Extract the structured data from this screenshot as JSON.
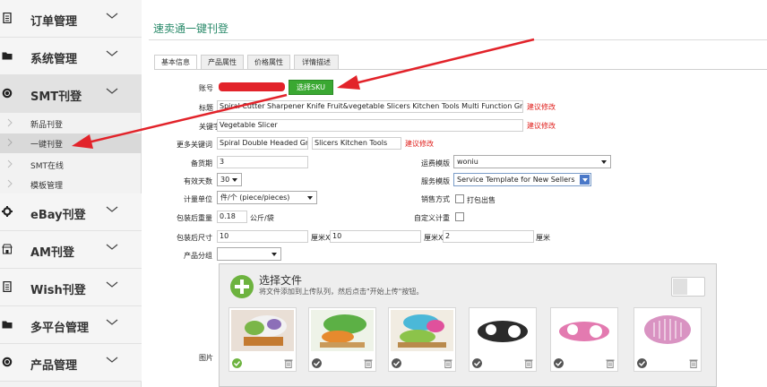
{
  "sidebar": {
    "nav": [
      {
        "label": "订单管理",
        "icon": "document-icon"
      },
      {
        "label": "系统管理",
        "icon": "folder-icon"
      },
      {
        "label": "SMT刊登",
        "icon": "globe-icon"
      },
      {
        "label": "eBay刊登",
        "icon": "gear-icon"
      },
      {
        "label": "AM刊登",
        "icon": "store-icon"
      },
      {
        "label": "Wish刊登",
        "icon": "document-icon"
      },
      {
        "label": "多平台管理",
        "icon": "folder-icon"
      },
      {
        "label": "产品管理",
        "icon": "globe-icon"
      }
    ],
    "sub_items": [
      {
        "label": "新品刊登"
      },
      {
        "label": "一键刊登"
      },
      {
        "label": "SMT在线"
      },
      {
        "label": "模板管理"
      }
    ]
  },
  "page": {
    "title": "速卖通一键刊登"
  },
  "tabs": [
    "基本信息",
    "产品属性",
    "价格属性",
    "详情描述"
  ],
  "form": {
    "account_label": "账号",
    "select_sku_button": "选择SKU",
    "title_label": "标题",
    "title_value": "Spiral Cutter Sharpener Knife Fruit&vegetable Slicers Kitchen Tools Multi Function Grate",
    "title_hint": "建议修改",
    "keyword_label": "关键字",
    "keyword_value": "Vegetable Slicer",
    "keyword_hint": "建议修改",
    "more_keywords_label": "更多关键词",
    "more_keyword_1": "Spiral Double Headed Gr",
    "more_keyword_2": "Slicers Kitchen Tools",
    "more_keywords_hint": "建议修改",
    "stock_days_label": "备货期",
    "stock_days_value": "3",
    "freight_template_label": "运费模版",
    "freight_template_value": "woniu",
    "valid_days_label": "有效天数",
    "valid_days_value": "30",
    "service_template_label": "服务模版",
    "service_template_value": "Service Template for New Sellers",
    "unit_label": "计量单位",
    "unit_value": "件/个 (piece/pieces)",
    "sale_method_label": "销售方式",
    "sale_method_option": "打包出售",
    "weight_label": "包装后重量",
    "weight_value": "0.18",
    "weight_unit": "公斤/袋",
    "custom_weight_label": "自定义计重",
    "size_label": "包装后尺寸",
    "size_length": "10",
    "size_width": "10",
    "size_height": "2",
    "size_x1": "厘米X",
    "size_x2": "厘米X",
    "size_unit": "厘米",
    "group_label": "产品分组",
    "group_value": "",
    "images_label": "图片"
  },
  "uploader": {
    "title": "选择文件",
    "hint": "将文件添加到上传队列，然后点击\"开始上传\"按钮。",
    "thumbnails": [
      {
        "name": "thumbnail-1",
        "status": "uploaded"
      },
      {
        "name": "thumbnail-2",
        "status": "pending"
      },
      {
        "name": "thumbnail-3",
        "status": "pending"
      },
      {
        "name": "thumbnail-4",
        "status": "pending"
      },
      {
        "name": "thumbnail-5",
        "status": "pending"
      },
      {
        "name": "thumbnail-6",
        "status": "pending"
      }
    ]
  },
  "colors": {
    "accent": "#3aa832",
    "title": "#2a8a6a",
    "warning": "#e0211e",
    "annotation_arrow": "#e2232a"
  }
}
